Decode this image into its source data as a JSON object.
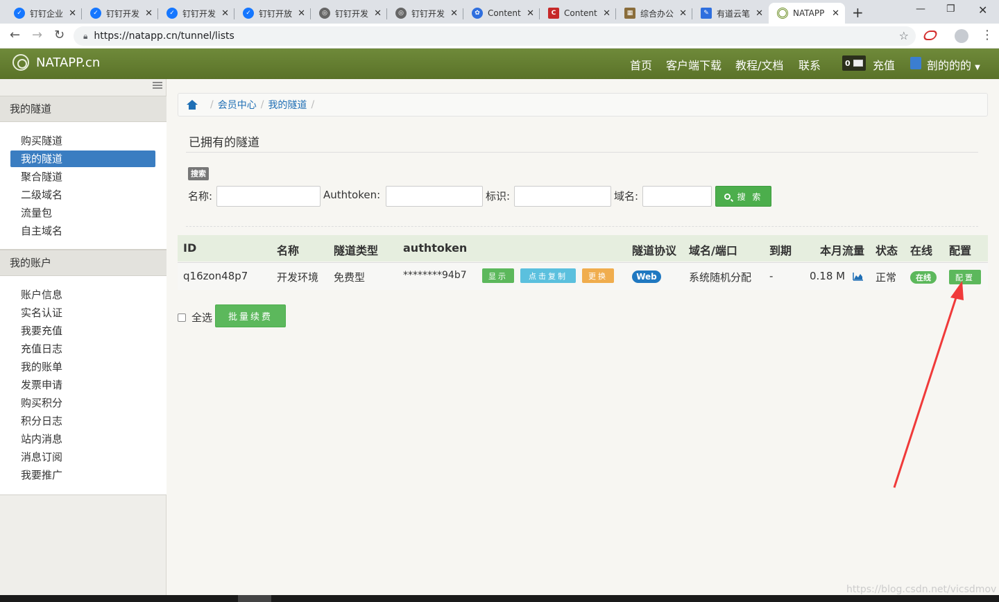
{
  "browser": {
    "tabs": [
      {
        "title": "钉钉企业",
        "favicon_color": "#1677ff"
      },
      {
        "title": "钉钉开发",
        "favicon_color": "#1677ff"
      },
      {
        "title": "钉钉开发",
        "favicon_color": "#1677ff"
      },
      {
        "title": "钉钉开放",
        "favicon_color": "#1677ff"
      },
      {
        "title": "钉钉开发",
        "favicon_color": "#666666"
      },
      {
        "title": "钉钉开发",
        "favicon_color": "#666666"
      },
      {
        "title": "Content",
        "favicon_color": "#2f6fde"
      },
      {
        "title": "Content",
        "favicon_color": "#c62828"
      },
      {
        "title": "综合办公",
        "favicon_color": "#8a6d3b"
      },
      {
        "title": "有道云笔",
        "favicon_color": "#2f6fde"
      },
      {
        "title": "NATAPP",
        "favicon_color": "#6b8e23"
      }
    ],
    "url": "https://natapp.cn/tunnel/lists",
    "new_tab_label": "+"
  },
  "header": {
    "brand": "NATAPP.cn",
    "nav": [
      "首页",
      "客户端下载",
      "教程/文档",
      "联系"
    ],
    "message_count": "0",
    "recharge": "充值",
    "username": "剖的的的",
    "accent_color": "#5a7228"
  },
  "sidebar": {
    "section1_title": "我的隧道",
    "section1_items": [
      "购买隧道",
      "我的隧道",
      "聚合隧道",
      "二级域名",
      "流量包",
      "自主域名"
    ],
    "active_item": "我的隧道",
    "section2_title": "我的账户",
    "section2_items": [
      "账户信息",
      "实名认证",
      "我要充值",
      "充值日志",
      "我的账单",
      "发票申请",
      "购买积分",
      "积分日志",
      "站内消息",
      "消息订阅",
      "我要推广"
    ]
  },
  "breadcrumb": [
    "会员中心",
    "我的隧道"
  ],
  "main": {
    "title": "已拥有的隧道",
    "search_tag": "搜索",
    "filters": {
      "name_label": "名称:",
      "authtoken_label": "Authtoken:",
      "tag_label": "标识:",
      "domain_label": "域名:"
    },
    "search_button": "搜 索"
  },
  "table": {
    "headers": [
      "ID",
      "名称",
      "隧道类型",
      "authtoken",
      "隧道协议",
      "域名/端口",
      "到期",
      "本月流量",
      "状态",
      "在线",
      "配置"
    ],
    "rows": [
      {
        "id": "q16zon48p7",
        "name": "开发环境",
        "type": "免费型",
        "authtoken": "********94b7",
        "btn_show": "显示",
        "btn_copy": "点击复制",
        "btn_change": "更换",
        "protocol": "Web",
        "domain": "系统随机分配",
        "expire": "-",
        "traffic": "0.18 M",
        "status": "正常",
        "online": "在线",
        "config": "配置"
      }
    ]
  },
  "footer_actions": {
    "select_all": "全选",
    "renew_button": "批量续费"
  },
  "watermark": "https://blog.csdn.net/vicsdmov"
}
